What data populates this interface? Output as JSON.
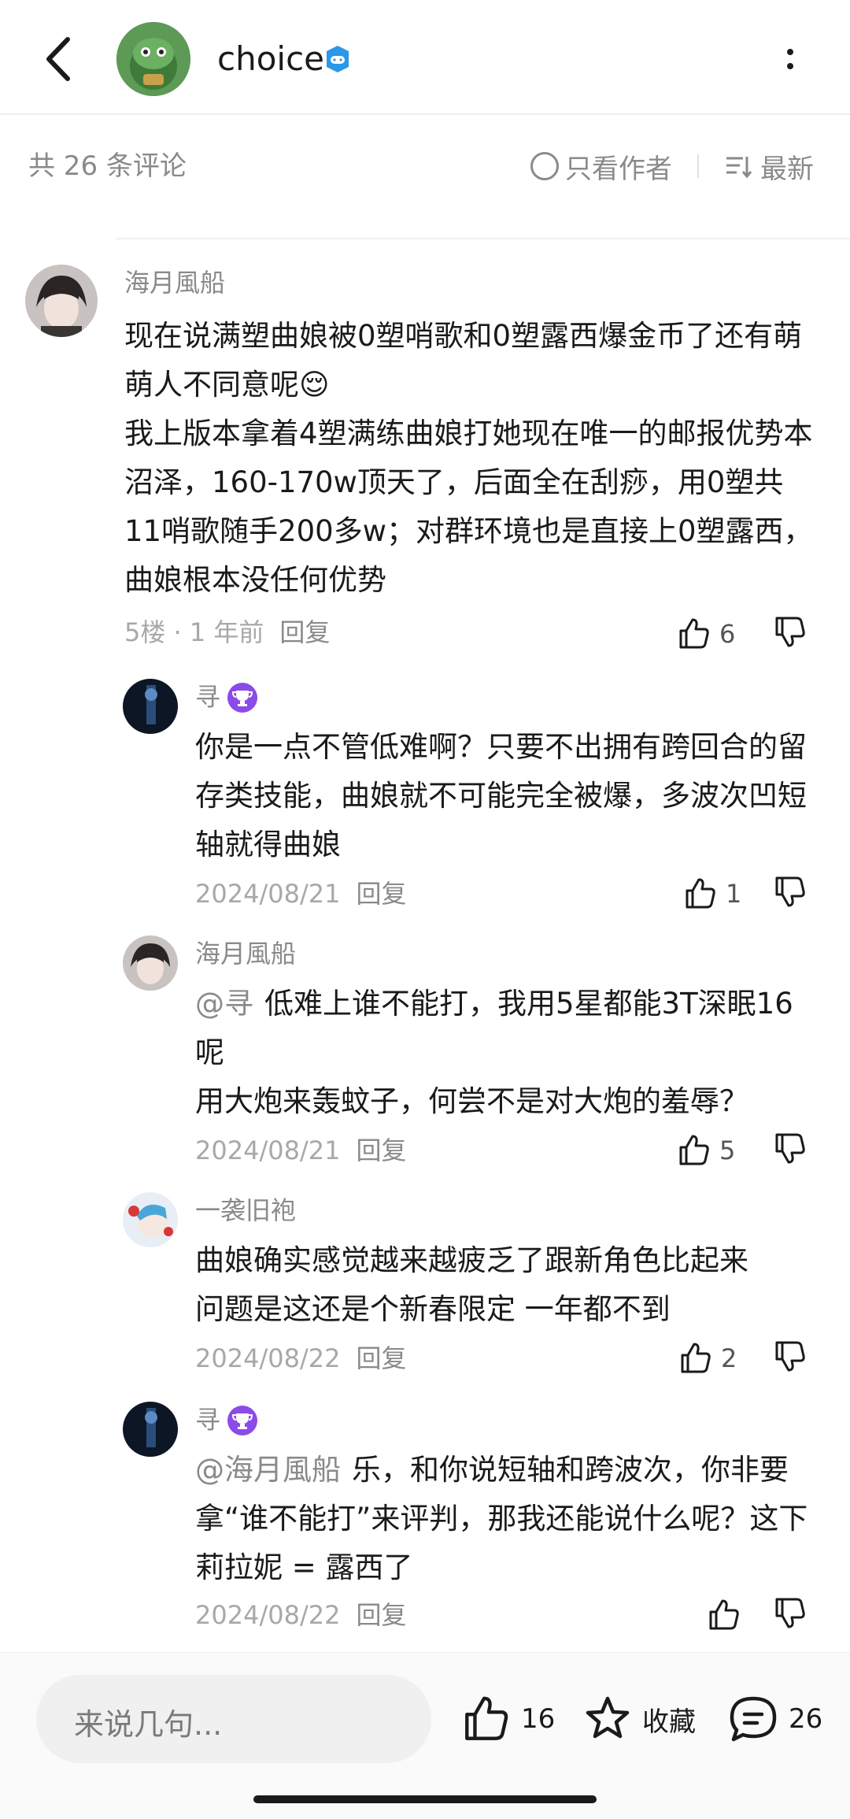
{
  "header": {
    "author_name": "choice",
    "icons": {
      "back": "chevron-left-icon",
      "verified": "gamepad-badge-icon",
      "more": "more-vertical-icon"
    },
    "colors": {
      "verified_badge": "#2a97e8"
    }
  },
  "comment_bar": {
    "count_label": "共 26 条评论",
    "only_author_label": "只看作者",
    "sort_label": "最新"
  },
  "comments": [
    {
      "author": "海月風船",
      "paragraphs": [
        "现在说满塑曲娘被0塑哨歌和0塑露西爆金币了还有萌萌人不同意呢😌",
        "我上版本拿着4塑满练曲娘打她现在唯一的邮报优势本沼泽，160-170w顶天了，后面全在刮痧，用0塑共11哨歌随手200多w；对群环境也是直接上0塑露西，曲娘根本没任何优势"
      ],
      "meta": "5楼 · 1 年前",
      "reply_label": "回复",
      "likes": "6"
    },
    {
      "author": "寻",
      "badge": "trophy-badge-icon",
      "paragraphs": [
        "你是一点不管低难啊？只要不出拥有跨回合的留存类技能，曲娘就不可能完全被爆，多波次凹短轴就得曲娘"
      ],
      "meta": "2024/08/21",
      "reply_label": "回复",
      "likes": "1"
    },
    {
      "author": "海月風船",
      "mention": "@寻",
      "paragraphs": [
        "低难上谁不能打，我用5星都能3T深眠16呢",
        "用大炮来轰蚊子，何尝不是对大炮的羞辱？"
      ],
      "meta": "2024/08/21",
      "reply_label": "回复",
      "likes": "5"
    },
    {
      "author": "一袭旧袍",
      "paragraphs": [
        "曲娘确实感觉越来越疲乏了跟新角色比起来",
        "问题是这还是个新春限定 一年都不到"
      ],
      "meta": "2024/08/22",
      "reply_label": "回复",
      "likes": "2"
    },
    {
      "author": "寻",
      "badge": "trophy-badge-icon",
      "mention": "@海月風船",
      "paragraphs": [
        "乐，和你说短轴和跨波次，你非要拿“谁不能打”来评判，那我还能说什么呢？这下莉拉妮 = 露西了"
      ],
      "meta": "2024/08/22",
      "reply_label": "回复",
      "likes": ""
    }
  ],
  "bottom_bar": {
    "input_placeholder": "来说几句...",
    "like_count": "16",
    "favorite_label": "收藏",
    "comment_count": "26",
    "icons": {
      "like": "thumbs-up-icon",
      "favorite": "star-icon",
      "comment": "comment-bubble-icon"
    }
  },
  "colors": {
    "badge_purple": "#8a4be8",
    "text_primary": "#1a1a1a",
    "text_secondary": "#8a8a8a"
  }
}
